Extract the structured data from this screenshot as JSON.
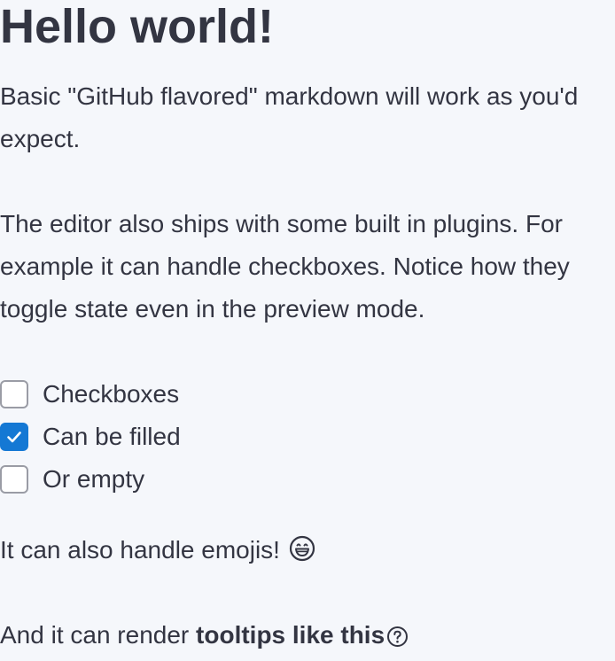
{
  "heading": "Hello world!",
  "paragraphs": {
    "markdown": "Basic \"GitHub flavored\" markdown will work as you'd expect.",
    "plugins": "The editor also ships with some built in plugins. For example it can handle checkboxes. Notice how they toggle state even in the preview mode.",
    "emoji_text": "It can also handle emojis!",
    "tooltip_prefix": "And it can render ",
    "tooltip_link": "tooltips like this"
  },
  "tasks": [
    {
      "label": "Checkboxes",
      "checked": false
    },
    {
      "label": "Can be filled",
      "checked": true
    },
    {
      "label": "Or empty",
      "checked": false
    }
  ],
  "icons": {
    "emoji": "grinning-face-icon",
    "tooltip": "help-circle-icon"
  },
  "colors": {
    "background": "#f5f7fb",
    "text": "#333542",
    "checkbox_checked": "#1478d4",
    "checkbox_border": "#9a9ca5"
  }
}
